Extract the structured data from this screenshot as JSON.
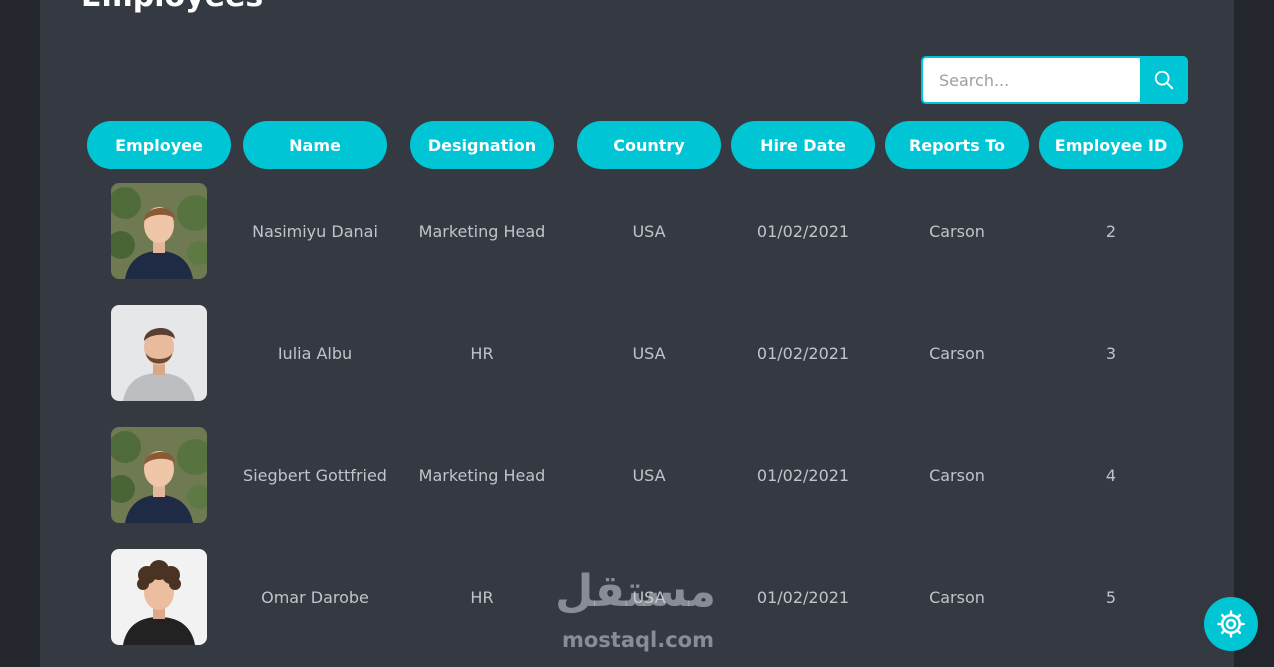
{
  "page": {
    "title": "Employees"
  },
  "search": {
    "placeholder": "Search...",
    "icon": "search-icon"
  },
  "table": {
    "columns": [
      "Employee",
      "Name",
      "Designation",
      "Country",
      "Hire Date",
      "Reports To",
      "Employee ID"
    ],
    "rows": [
      {
        "photo": "employee-photo",
        "name": "Nasimiyu Danai",
        "designation": "Marketing Head",
        "country": "USA",
        "hire_date": "01/02/2021",
        "reports_to": "Carson",
        "employee_id": "2"
      },
      {
        "photo": "employee-photo",
        "name": "Iulia Albu",
        "designation": "HR",
        "country": "USA",
        "hire_date": "01/02/2021",
        "reports_to": "Carson",
        "employee_id": "3"
      },
      {
        "photo": "employee-photo",
        "name": "Siegbert Gottfried",
        "designation": "Marketing Head",
        "country": "USA",
        "hire_date": "01/02/2021",
        "reports_to": "Carson",
        "employee_id": "4"
      },
      {
        "photo": "employee-photo",
        "name": "Omar Darobe",
        "designation": "HR",
        "country": "USA",
        "hire_date": "01/02/2021",
        "reports_to": "Carson",
        "employee_id": "5"
      }
    ]
  },
  "watermark": {
    "word": "مستقل",
    "url": "mostaql.com"
  },
  "settings": {
    "icon": "gear-icon"
  },
  "colors": {
    "accent": "#00c5d4",
    "panel": "#353942",
    "background": "#23262d",
    "cell_text": "#c0c4ca"
  }
}
